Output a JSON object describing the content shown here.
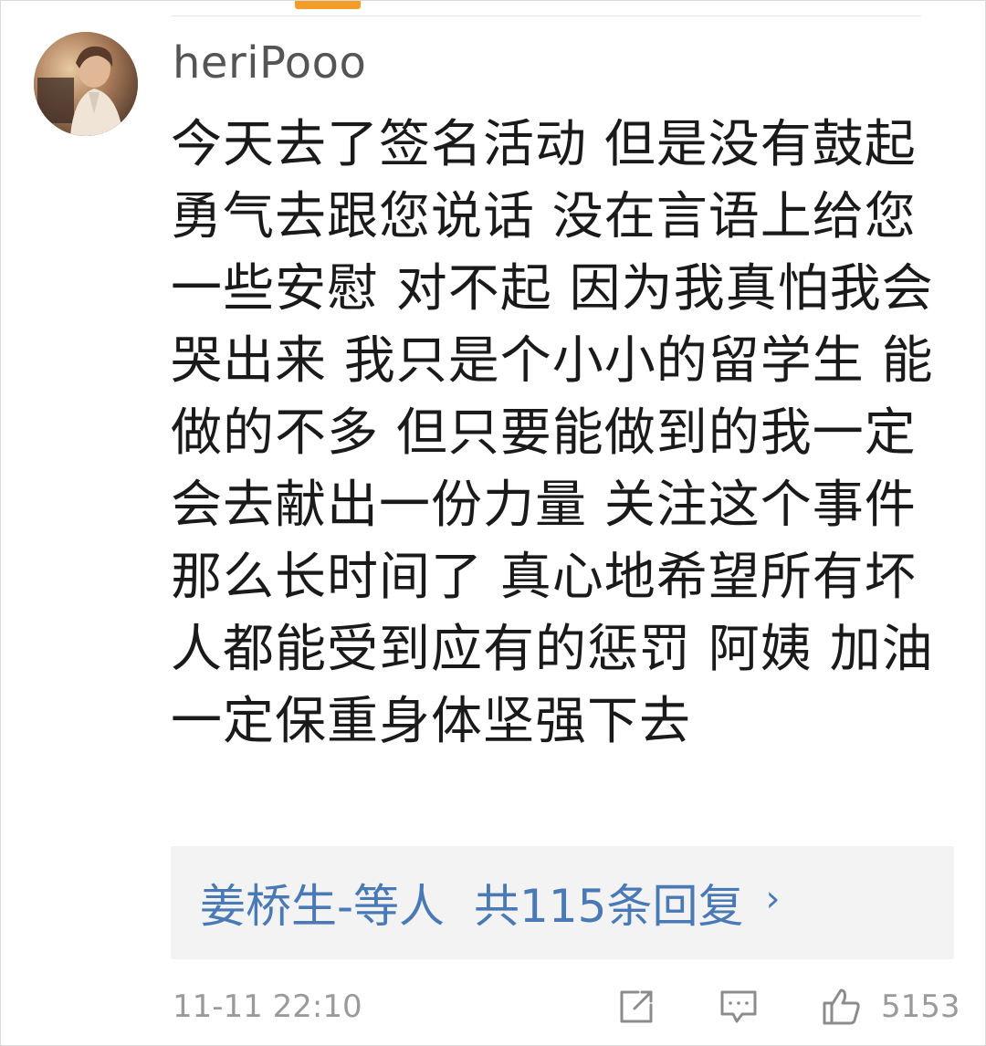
{
  "comment": {
    "username": "heriPooo",
    "text": "今天去了签名活动 但是没有鼓起勇气去跟您说话 没在言语上给您一些安慰 对不起 因为我真怕我会哭出来 我只是个小小的留学生 能做的不多 但只要能做到的我一定会去献出一份力量 关注这个事件那么长时间了 真心地希望所有坏人都能受到应有的惩罚 阿姨 加油 一定保重身体坚强下去",
    "replies": {
      "repliers": "姜桥生-等人",
      "count_label": "共115条回复",
      "chevron": "›"
    },
    "timestamp": "11-11 22:10",
    "like_count": "5153"
  },
  "icons": {
    "share": "share-icon",
    "comment": "comment-icon",
    "like": "thumbs-up-icon"
  },
  "colors": {
    "accent": "#f39c28",
    "link": "#4a7ab5",
    "meta": "#9a9a9a"
  }
}
